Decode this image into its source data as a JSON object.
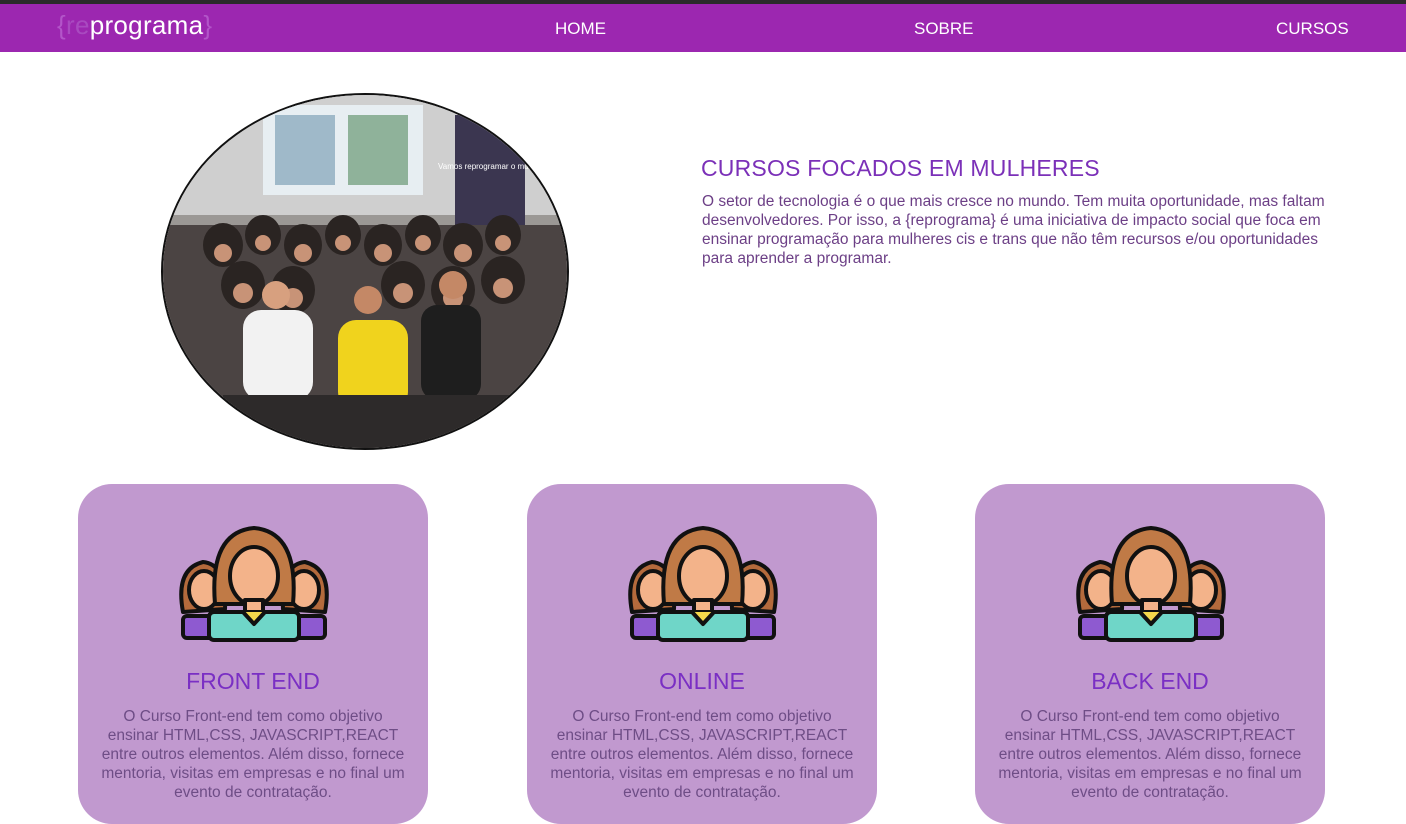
{
  "header": {
    "logo": {
      "brace_open": "{",
      "re": "re",
      "programa": "programa",
      "brace_close": "}"
    },
    "nav": [
      {
        "label": "HOME"
      },
      {
        "label": "SOBRE"
      },
      {
        "label": "CURSOS"
      }
    ]
  },
  "hero": {
    "image_alt": "Grupo de mulheres fazendo coração com as mãos",
    "banner_text": "Vamos reprogramar o mundo",
    "title": "CURSOS FOCADOS EM MULHERES",
    "text": "O setor de tecnologia é o que mais cresce no mundo. Tem muita oportunidade, mas faltam desenvolvedores. Por isso, a {reprograma} é uma iniciativa de impacto social que foca em ensinar programação para mulheres cis e trans que não têm recursos e/ou oportunidades para aprender a programar."
  },
  "cards": [
    {
      "icon": "women-group-icon",
      "title": "FRONT END",
      "description": "O Curso Front-end tem como objetivo ensinar HTML,CSS, JAVASCRIPT,REACT entre outros elementos. Além disso, fornece mentoria, visitas em empresas e no final um evento de contratação."
    },
    {
      "icon": "women-group-icon",
      "title": "ONLINE",
      "description": "O Curso Front-end tem como objetivo ensinar HTML,CSS, JAVASCRIPT,REACT entre outros elementos. Além disso, fornece mentoria, visitas em empresas e no final um evento de contratação."
    },
    {
      "icon": "women-group-icon",
      "title": "BACK END",
      "description": "O Curso Front-end tem como objetivo ensinar HTML,CSS, JAVASCRIPT,REACT entre outros elementos. Além disso, fornece mentoria, visitas em empresas e no final um evento de contratação."
    }
  ],
  "colors": {
    "navbar": "#9c27b0",
    "card": "#c199cf",
    "heading": "#7b30b8",
    "card_title": "#7a2fc4",
    "body_text": "#6c3f86"
  }
}
